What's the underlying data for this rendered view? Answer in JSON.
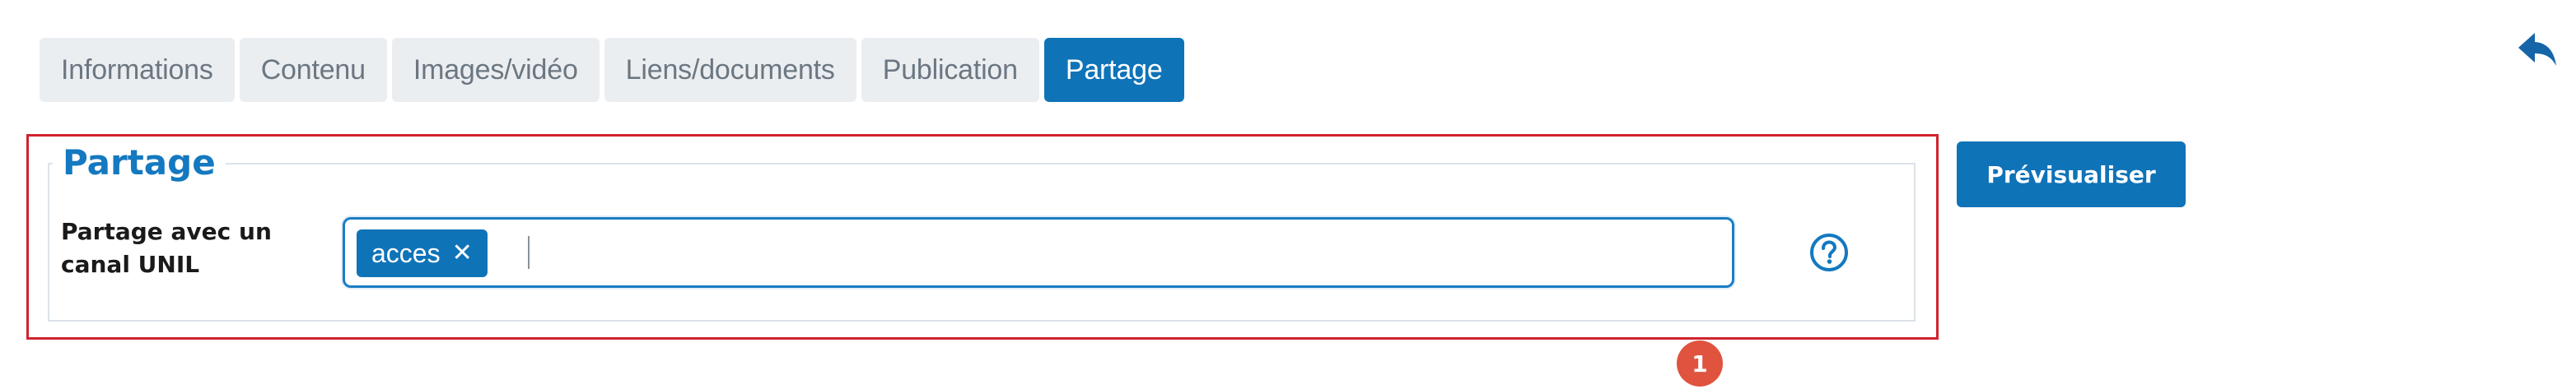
{
  "tabs": [
    {
      "label": "Informations",
      "active": false
    },
    {
      "label": "Contenu",
      "active": false
    },
    {
      "label": "Images/vidéo",
      "active": false
    },
    {
      "label": "Liens/documents",
      "active": false
    },
    {
      "label": "Publication",
      "active": false
    },
    {
      "label": "Partage",
      "active": true
    }
  ],
  "section": {
    "legend": "Partage",
    "field_label": "Partage avec un canal UNIL",
    "tags": [
      {
        "label": "acces"
      }
    ],
    "input_value": ""
  },
  "actions": {
    "preview_label": "Prévisualiser"
  },
  "annotation": {
    "marker_number": "1"
  },
  "icons": {
    "back": "reply-arrow-icon",
    "help": "question-circle-icon",
    "remove_tag": "close-icon"
  },
  "colors": {
    "accent": "#0f73b8",
    "tab_inactive_bg": "#ebeef1",
    "tab_inactive_text": "#6b7781",
    "highlight": "#d0232f",
    "marker": "#e0533f"
  }
}
